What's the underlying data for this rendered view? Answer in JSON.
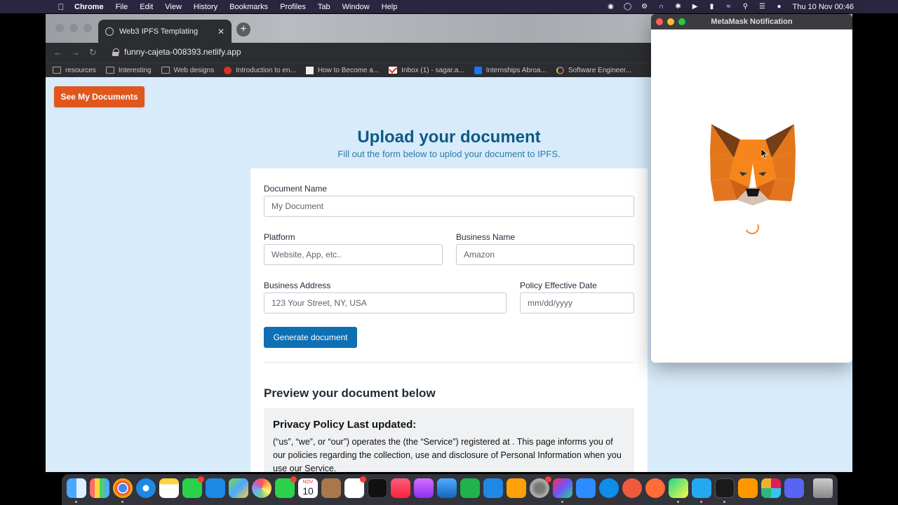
{
  "menubar": {
    "app": "Chrome",
    "items": [
      "File",
      "Edit",
      "View",
      "History",
      "Bookmarks",
      "Profiles",
      "Tab",
      "Window",
      "Help"
    ],
    "clock": "Thu 10 Nov  00:46"
  },
  "browser": {
    "tab_title": "Web3 IPFS Templating",
    "url": "funny-cajeta-008393.netlify.app",
    "bookmarks": [
      {
        "label": "resources",
        "icon": "folder-icon"
      },
      {
        "label": "Interesting",
        "icon": "folder-icon"
      },
      {
        "label": "Web designs",
        "icon": "folder-icon"
      },
      {
        "label": "Introduction to en...",
        "icon": "red-circle-icon"
      },
      {
        "label": "How to Become a...",
        "icon": "hw-icon"
      },
      {
        "label": "Inbox (1) - sagar.a...",
        "icon": "gmail-icon"
      },
      {
        "label": "Internships Abroa...",
        "icon": "facebook-icon"
      },
      {
        "label": "Software Engineer...",
        "icon": "google-icon"
      }
    ]
  },
  "page": {
    "see_docs_label": "See My Documents",
    "heading": "Upload your document",
    "subheading": "Fill out the form below to uplod your document to IPFS.",
    "form": {
      "document_name": {
        "label": "Document Name",
        "placeholder": "My Document"
      },
      "platform": {
        "label": "Platform",
        "placeholder": "Website, App, etc.."
      },
      "business_name": {
        "label": "Business Name",
        "placeholder": "Amazon"
      },
      "business_address": {
        "label": "Business Address",
        "placeholder": "123 Your Street, NY, USA"
      },
      "policy_date": {
        "label": "Policy Effective Date",
        "placeholder": "mm/dd/yyyy"
      },
      "generate_label": "Generate document"
    },
    "preview": {
      "title": "Preview your document below",
      "doc_title": "Privacy Policy Last updated:",
      "doc_body": "(“us”, “we”, or “our”) operates the (the “Service”) registered at . This page informs you of our policies regarding the collection, use and disclosure of Personal Information when you use our Service."
    }
  },
  "metamask": {
    "title": "MetaMask Notification"
  },
  "dock": {
    "calendar_month": "NOV",
    "calendar_day": "10"
  },
  "colors": {
    "page_bg": "#d8ebfa",
    "accent_orange": "#e0571e",
    "primary_blue": "#0e6fb3",
    "heading_blue": "#0d5a86"
  }
}
